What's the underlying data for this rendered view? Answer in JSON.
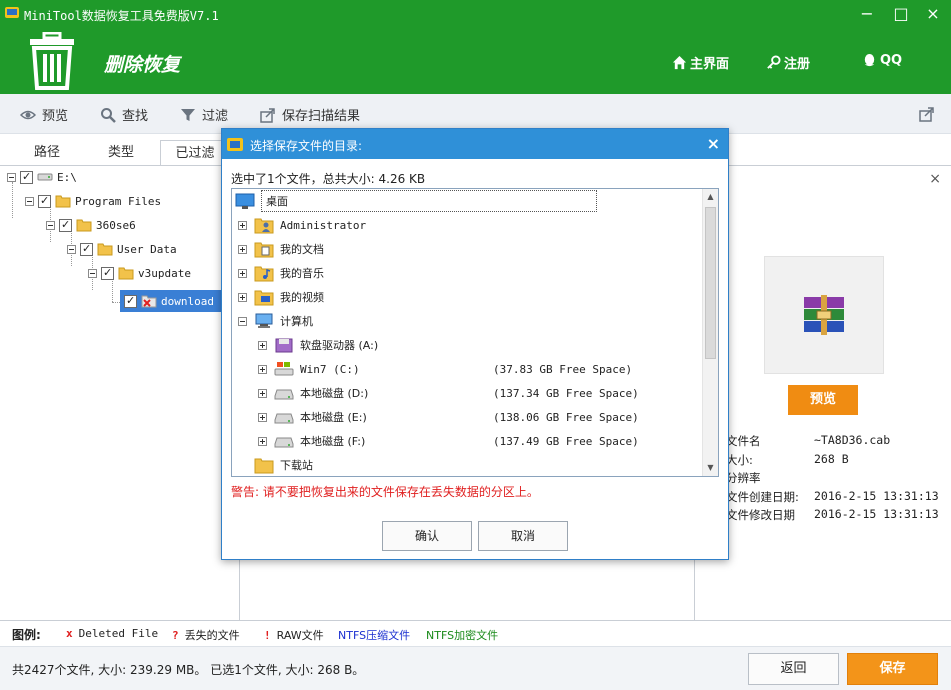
{
  "window": {
    "title": "MiniTool数据恢复工具免费版V7.1",
    "minimize": "−",
    "maximize": "□",
    "close": "×"
  },
  "header": {
    "module_title": "删除恢复",
    "links": [
      {
        "label": "主界面",
        "icon": "home-icon"
      },
      {
        "label": "注册",
        "icon": "key-icon"
      },
      {
        "label": "QQ",
        "icon": "qq-icon"
      }
    ],
    "bg_color": "#1f9a2a"
  },
  "toolbar": {
    "preview": "预览",
    "find": "查找",
    "filter": "过滤",
    "save_scan": "保存扫描结果"
  },
  "tabs": [
    "路径",
    "类型",
    "已过滤"
  ],
  "tree": [
    {
      "label": "E:\\",
      "checked": true
    },
    {
      "label": "Program Files",
      "checked": true
    },
    {
      "label": "360se6",
      "checked": true
    },
    {
      "label": "User Data",
      "checked": true
    },
    {
      "label": "v3update",
      "checked": true
    },
    {
      "label": "download",
      "checked": true,
      "selected": true
    }
  ],
  "preview_panel": {
    "close": "×",
    "preview_button": "预览",
    "info": [
      {
        "key": "文件名",
        "value": "~TA8D36.cab"
      },
      {
        "key": "大小:",
        "value": "268 B"
      },
      {
        "key": "分辨率",
        "value": ""
      },
      {
        "key": "文件创建日期:",
        "value": "2016-2-15 13:31:13"
      },
      {
        "key": "文件修改日期",
        "value": "2016-2-15 13:31:13"
      }
    ]
  },
  "legend": {
    "title": "图例:",
    "items": [
      {
        "symbol": "x",
        "label": "Deleted File",
        "color": "#e02020"
      },
      {
        "symbol": "?",
        "label": "丢失的文件",
        "color": "#e02020"
      },
      {
        "symbol": "!",
        "label": "RAW文件",
        "color": "#e02020"
      },
      {
        "symbol": "",
        "label": "NTFS压缩文件",
        "color": "#1a2fd0"
      },
      {
        "symbol": "",
        "label": "NTFS加密文件",
        "color": "#1a8a1a"
      }
    ]
  },
  "status": {
    "text": "共2427个文件, 大小: 239.29 MB。 已选1个文件, 大小: 268 B。",
    "back": "返回",
    "save": "保存"
  },
  "dialog": {
    "title": "选择保存文件的目录:",
    "close": "×",
    "summary": "选中了1个文件，总共大小: 4.26 KB",
    "root": "桌面",
    "items": [
      {
        "label": "Administrator",
        "icon": "user-folder-icon",
        "free": ""
      },
      {
        "label": "我的文档",
        "icon": "documents-folder-icon",
        "free": ""
      },
      {
        "label": "我的音乐",
        "icon": "music-folder-icon",
        "free": ""
      },
      {
        "label": "我的视频",
        "icon": "video-folder-icon",
        "free": ""
      },
      {
        "label": "计算机",
        "icon": "computer-icon",
        "free": "",
        "expanded": true
      },
      {
        "label": "软盘驱动器 (A:)",
        "icon": "floppy-icon",
        "free": "",
        "child": true
      },
      {
        "label": "Win7 (C:)",
        "icon": "windows-drive-icon",
        "free": "(37.83 GB Free Space)",
        "child": true
      },
      {
        "label": "本地磁盘 (D:)",
        "icon": "drive-icon",
        "free": "(137.34 GB Free Space)",
        "child": true
      },
      {
        "label": "本地磁盘 (E:)",
        "icon": "drive-icon",
        "free": "(138.06 GB Free Space)",
        "child": true
      },
      {
        "label": "本地磁盘 (F:)",
        "icon": "drive-icon",
        "free": "(137.49 GB Free Space)",
        "child": true
      },
      {
        "label": "下载站",
        "icon": "folder-icon",
        "free": "",
        "noexpand": true
      }
    ],
    "warning": "警告: 请不要把恢复出来的文件保存在丢失数据的分区上。",
    "ok": "确认",
    "cancel": "取消"
  }
}
